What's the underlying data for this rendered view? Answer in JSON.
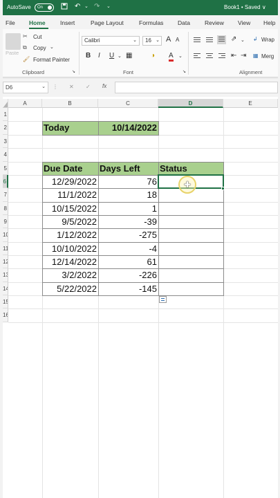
{
  "window": {
    "autosave_label": "AutoSave",
    "autosave_state": "On",
    "doc_name": "Book1 • Saved ∨"
  },
  "quick_access": [
    "save-icon",
    "undo-icon",
    "redo-icon"
  ],
  "tabs": [
    {
      "label": "File"
    },
    {
      "label": "Home"
    },
    {
      "label": "Insert"
    },
    {
      "label": "Page Layout"
    },
    {
      "label": "Formulas"
    },
    {
      "label": "Data"
    },
    {
      "label": "Review"
    },
    {
      "label": "View"
    },
    {
      "label": "Help"
    }
  ],
  "active_tab": "Home",
  "ribbon": {
    "clipboard": {
      "paste_label": "Paste",
      "cut_label": "Cut",
      "copy_label": "Copy",
      "format_painter_label": "Format Painter",
      "group_label": "Clipboard"
    },
    "font": {
      "font_name": "Calibri",
      "font_size": "16",
      "bold": "B",
      "italic": "I",
      "underline": "U",
      "font_color_glyph": "A",
      "group_label": "Font"
    },
    "alignment": {
      "wrap_label": "Wrap",
      "merge_label": "Merg",
      "group_label": "Alignment"
    }
  },
  "formula_bar": {
    "name_box": "D6",
    "cancel_glyph": "✕",
    "enter_glyph": "✓",
    "fx_label": "fx",
    "content": ""
  },
  "columns": [
    "A",
    "B",
    "C",
    "D",
    "E"
  ],
  "rows": [
    "1",
    "2",
    "3",
    "4",
    "5",
    "6",
    "7",
    "8",
    "9",
    "10",
    "11",
    "12",
    "13",
    "14",
    "15",
    "16"
  ],
  "active_cell": "D6",
  "sheet": {
    "today_label": "Today",
    "today_value": "10/14/2022",
    "headers": [
      "Due Date",
      "Days Left",
      "Status"
    ],
    "records": [
      {
        "due": "12/29/2022",
        "days": "76",
        "status": ""
      },
      {
        "due": "11/1/2022",
        "days": "18",
        "status": ""
      },
      {
        "due": "10/15/2022",
        "days": "1",
        "status": ""
      },
      {
        "due": "9/5/2022",
        "days": "-39",
        "status": ""
      },
      {
        "due": "1/12/2022",
        "days": "-275",
        "status": ""
      },
      {
        "due": "10/10/2022",
        "days": "-4",
        "status": ""
      },
      {
        "due": "12/14/2022",
        "days": "61",
        "status": ""
      },
      {
        "due": "3/2/2022",
        "days": "-226",
        "status": ""
      },
      {
        "due": "5/22/2022",
        "days": "-145",
        "status": ""
      }
    ]
  },
  "colors": {
    "accent": "#1f7145",
    "header_fill": "#a9d08e"
  }
}
